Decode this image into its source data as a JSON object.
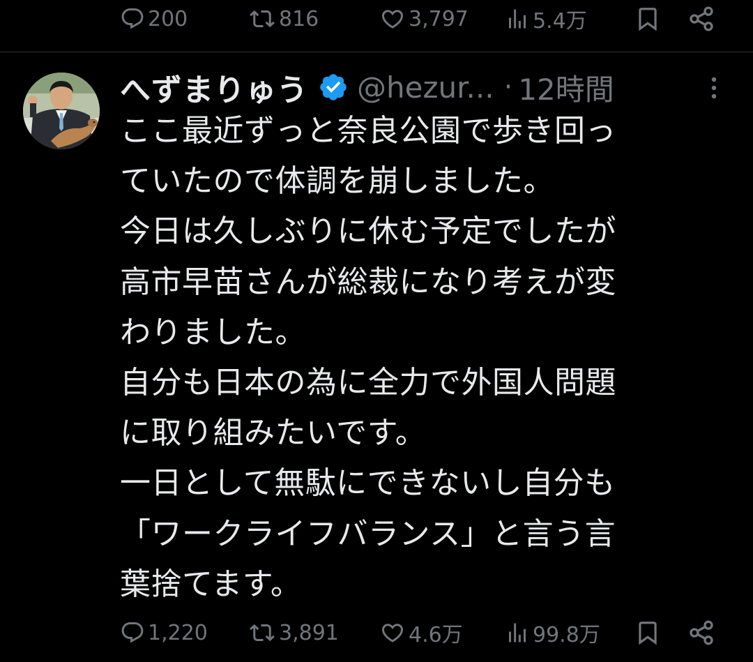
{
  "previous_tweet": {
    "actions": {
      "replies": "200",
      "retweets": "816",
      "likes": "3,797",
      "views": "5.4万"
    }
  },
  "tweet": {
    "display_name": "へずまりゅう",
    "handle": "@hezur...",
    "separator": "·",
    "time": "12時間",
    "text_lines": [
      "ここ最近ずっと奈良公園で歩き回っ",
      "ていたので体調を崩しました。",
      "今日は久しぶりに休む予定でしたが",
      "高市早苗さんが総裁になり考えが変",
      "わりました。",
      "自分も日本の為に全力で外国人問題",
      "に取り組みたいです。",
      "一日として無駄にできないし自分も",
      "「ワークライフバランス」と言う言",
      "葉捨てます。"
    ],
    "actions": {
      "replies": "1,220",
      "retweets": "3,891",
      "likes": "4.6万",
      "views": "99.8万"
    }
  },
  "colors": {
    "background": "#000000",
    "text": "#e7e9ea",
    "muted": "#71767b",
    "verified": "#1d9bf0",
    "divider": "#2f3336"
  },
  "icons": [
    "reply-icon",
    "retweet-icon",
    "like-icon",
    "views-icon",
    "bookmark-icon",
    "share-icon",
    "verified-badge-icon",
    "more-options-icon"
  ]
}
